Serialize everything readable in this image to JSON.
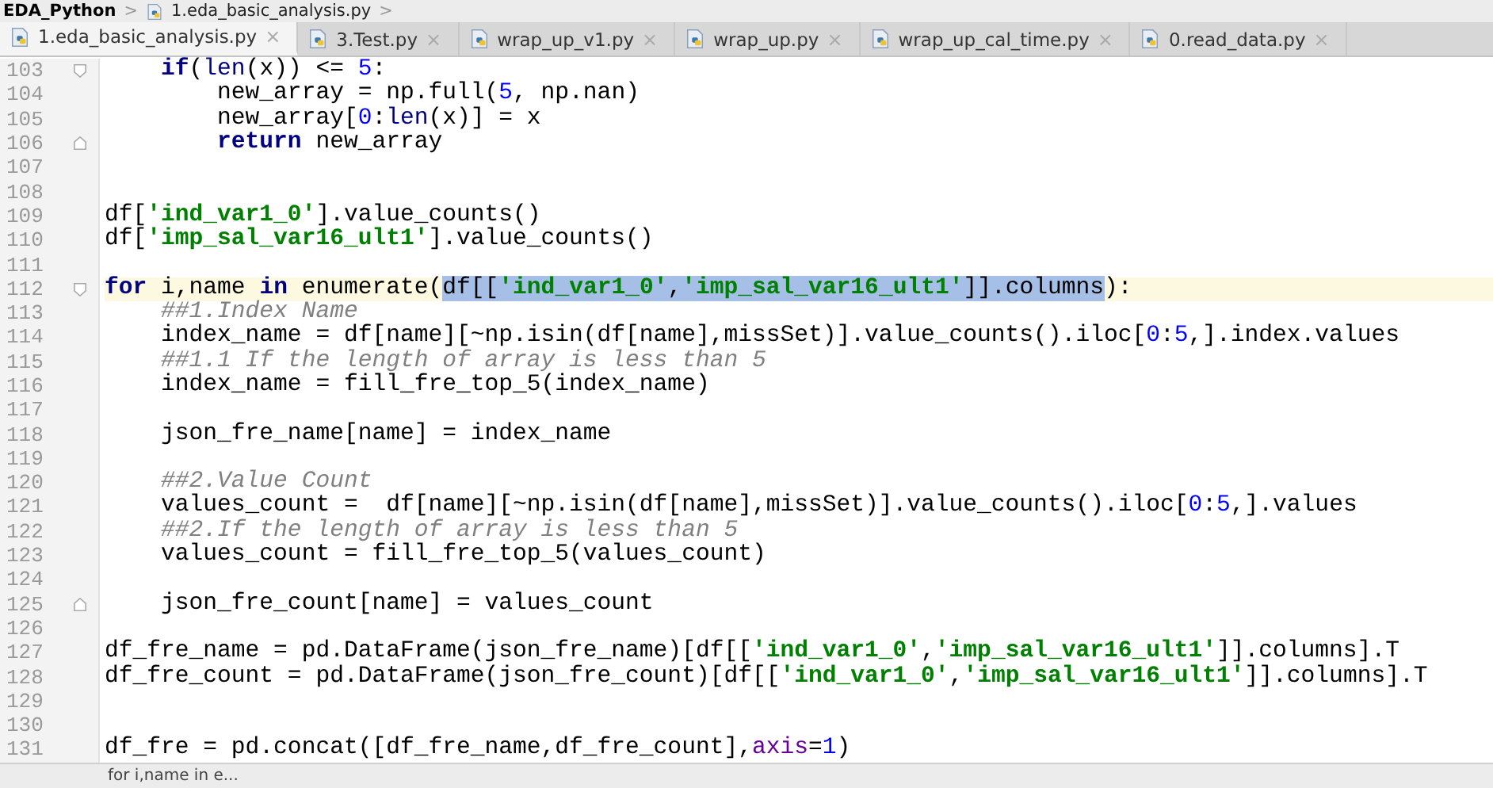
{
  "breadcrumb": {
    "project": "EDA_Python",
    "file": "1.eda_basic_analysis.py",
    "separators": [
      ">",
      ">"
    ]
  },
  "tabs": [
    {
      "label": "1.eda_basic_analysis.py",
      "close": "×",
      "selected": true
    },
    {
      "label": "3.Test.py",
      "close": "×",
      "selected": false
    },
    {
      "label": "wrap_up_v1.py",
      "close": "×",
      "selected": false
    },
    {
      "label": "wrap_up.py",
      "close": "×",
      "selected": false
    },
    {
      "label": "wrap_up_cal_time.py",
      "close": "×",
      "selected": false
    },
    {
      "label": "0.read_data.py",
      "close": "×",
      "selected": false
    }
  ],
  "editor": {
    "lines": [
      {
        "number": "103",
        "current": false,
        "fold_start": true,
        "fold_end": false,
        "tokens": [
          {
            "text": "    if",
            "kind": "keyword"
          },
          {
            "text": "(",
            "kind": "plain"
          },
          {
            "text": "len",
            "kind": "builtin"
          },
          {
            "text": "(x)) <= ",
            "kind": "plain"
          },
          {
            "text": "5",
            "kind": "number"
          },
          {
            "text": ":",
            "kind": "plain"
          }
        ]
      },
      {
        "number": "104",
        "current": false,
        "fold_start": false,
        "fold_end": false,
        "tokens": [
          {
            "text": "        new_array = np.full(",
            "kind": "plain"
          },
          {
            "text": "5",
            "kind": "number"
          },
          {
            "text": ", np.nan)",
            "kind": "plain"
          }
        ]
      },
      {
        "number": "105",
        "current": false,
        "fold_start": false,
        "fold_end": false,
        "tokens": [
          {
            "text": "        new_array[",
            "kind": "plain"
          },
          {
            "text": "0",
            "kind": "number"
          },
          {
            "text": ":",
            "kind": "plain"
          },
          {
            "text": "len",
            "kind": "builtin"
          },
          {
            "text": "(x)] = x",
            "kind": "plain"
          }
        ]
      },
      {
        "number": "106",
        "current": false,
        "fold_start": false,
        "fold_end": true,
        "tokens": [
          {
            "text": "        return",
            "kind": "keyword"
          },
          {
            "text": " new_array",
            "kind": "plain"
          }
        ]
      },
      {
        "number": "107",
        "current": false,
        "fold_start": false,
        "fold_end": false
      },
      {
        "number": "108",
        "current": false,
        "fold_start": false,
        "fold_end": false
      },
      {
        "number": "109",
        "current": false,
        "fold_start": false,
        "fold_end": false,
        "tokens": [
          {
            "text": "df[",
            "kind": "plain"
          },
          {
            "text": "'ind_var1_0'",
            "kind": "string"
          },
          {
            "text": "].value_counts()",
            "kind": "plain"
          }
        ]
      },
      {
        "number": "110",
        "current": false,
        "fold_start": false,
        "fold_end": false,
        "tokens": [
          {
            "text": "df[",
            "kind": "plain"
          },
          {
            "text": "'imp_sal_var16_ult1'",
            "kind": "string"
          },
          {
            "text": "].value_counts()",
            "kind": "plain"
          }
        ]
      },
      {
        "number": "111",
        "current": false,
        "fold_start": false,
        "fold_end": false
      },
      {
        "number": "112",
        "current": true,
        "fold_start": true,
        "fold_end": false,
        "tokens": [
          {
            "text": "for",
            "kind": "keyword"
          },
          {
            "text": " i,name ",
            "kind": "plain"
          },
          {
            "text": "in",
            "kind": "keyword"
          },
          {
            "text": " enumerate(",
            "kind": "plain"
          },
          {
            "text": "df[[",
            "kind": "selected"
          },
          {
            "text": "'ind_var1_0'",
            "kind": "selected-string"
          },
          {
            "text": ",",
            "kind": "selected"
          },
          {
            "text": "'imp_sal_var16_ult1'",
            "kind": "selected-string"
          },
          {
            "text": "]].columns",
            "kind": "selected"
          },
          {
            "text": "):",
            "kind": "plain"
          }
        ]
      },
      {
        "number": "113",
        "current": false,
        "fold_start": false,
        "fold_end": false,
        "tokens": [
          {
            "text": "    ##1.Index Name",
            "kind": "comment"
          }
        ]
      },
      {
        "number": "114",
        "current": false,
        "fold_start": false,
        "fold_end": false,
        "tokens": [
          {
            "text": "    index_name = df[name][~np.isin(df[name],missSet)].value_counts().iloc[",
            "kind": "plain"
          },
          {
            "text": "0",
            "kind": "number"
          },
          {
            "text": ":",
            "kind": "plain"
          },
          {
            "text": "5",
            "kind": "number"
          },
          {
            "text": ",].index.values",
            "kind": "plain"
          }
        ]
      },
      {
        "number": "115",
        "current": false,
        "fold_start": false,
        "fold_end": false,
        "tokens": [
          {
            "text": "    ##1.1 If the length of array is less than 5",
            "kind": "comment"
          }
        ]
      },
      {
        "number": "116",
        "current": false,
        "fold_start": false,
        "fold_end": false,
        "tokens": [
          {
            "text": "    index_name = fill_fre_top_5(index_name)",
            "kind": "plain"
          }
        ]
      },
      {
        "number": "117",
        "current": false,
        "fold_start": false,
        "fold_end": false
      },
      {
        "number": "118",
        "current": false,
        "fold_start": false,
        "fold_end": false,
        "tokens": [
          {
            "text": "    json_fre_name[name] = index_name",
            "kind": "plain"
          }
        ]
      },
      {
        "number": "119",
        "current": false,
        "fold_start": false,
        "fold_end": false
      },
      {
        "number": "120",
        "current": false,
        "fold_start": false,
        "fold_end": false,
        "tokens": [
          {
            "text": "    ##2.Value Count",
            "kind": "comment"
          }
        ]
      },
      {
        "number": "121",
        "current": false,
        "fold_start": false,
        "fold_end": false,
        "tokens": [
          {
            "text": "    values_count =  df[name][~np.isin(df[name],missSet)].value_counts().iloc[",
            "kind": "plain"
          },
          {
            "text": "0",
            "kind": "number"
          },
          {
            "text": ":",
            "kind": "plain"
          },
          {
            "text": "5",
            "kind": "number"
          },
          {
            "text": ",].values",
            "kind": "plain"
          }
        ]
      },
      {
        "number": "122",
        "current": false,
        "fold_start": false,
        "fold_end": false,
        "tokens": [
          {
            "text": "    ##2.If the length of array is less than 5",
            "kind": "comment"
          }
        ]
      },
      {
        "number": "123",
        "current": false,
        "fold_start": false,
        "fold_end": false,
        "tokens": [
          {
            "text": "    values_count = fill_fre_top_5(values_count)",
            "kind": "plain"
          }
        ]
      },
      {
        "number": "124",
        "current": false,
        "fold_start": false,
        "fold_end": false
      },
      {
        "number": "125",
        "current": false,
        "fold_start": false,
        "fold_end": true,
        "tokens": [
          {
            "text": "    json_fre_count[name] = values_count",
            "kind": "plain"
          }
        ]
      },
      {
        "number": "126",
        "current": false,
        "fold_start": false,
        "fold_end": false
      },
      {
        "number": "127",
        "current": false,
        "fold_start": false,
        "fold_end": false,
        "tokens": [
          {
            "text": "df_fre_name = pd.DataFrame(json_fre_name)[df[[",
            "kind": "plain"
          },
          {
            "text": "'ind_var1_0'",
            "kind": "string"
          },
          {
            "text": ",",
            "kind": "plain"
          },
          {
            "text": "'imp_sal_var16_ult1'",
            "kind": "string"
          },
          {
            "text": "]].columns].T",
            "kind": "plain"
          }
        ]
      },
      {
        "number": "128",
        "current": false,
        "fold_start": false,
        "fold_end": false,
        "tokens": [
          {
            "text": "df_fre_count = pd.DataFrame(json_fre_count)[df[[",
            "kind": "plain"
          },
          {
            "text": "'ind_var1_0'",
            "kind": "string"
          },
          {
            "text": ",",
            "kind": "plain"
          },
          {
            "text": "'imp_sal_var16_ult1'",
            "kind": "string"
          },
          {
            "text": "]].columns].T",
            "kind": "plain"
          }
        ]
      },
      {
        "number": "129",
        "current": false,
        "fold_start": false,
        "fold_end": false
      },
      {
        "number": "130",
        "current": false,
        "fold_start": false,
        "fold_end": false
      },
      {
        "number": "131",
        "current": false,
        "fold_start": false,
        "fold_end": false,
        "tokens": [
          {
            "text": "df_fre = pd.concat([df_fre_name,df_fre_count],",
            "kind": "plain"
          },
          {
            "text": "axis",
            "kind": "param"
          },
          {
            "text": "=",
            "kind": "plain"
          },
          {
            "text": "1",
            "kind": "number"
          },
          {
            "text": ")",
            "kind": "plain"
          }
        ]
      }
    ]
  },
  "status_bar": {
    "text": "for i,name in e..."
  }
}
